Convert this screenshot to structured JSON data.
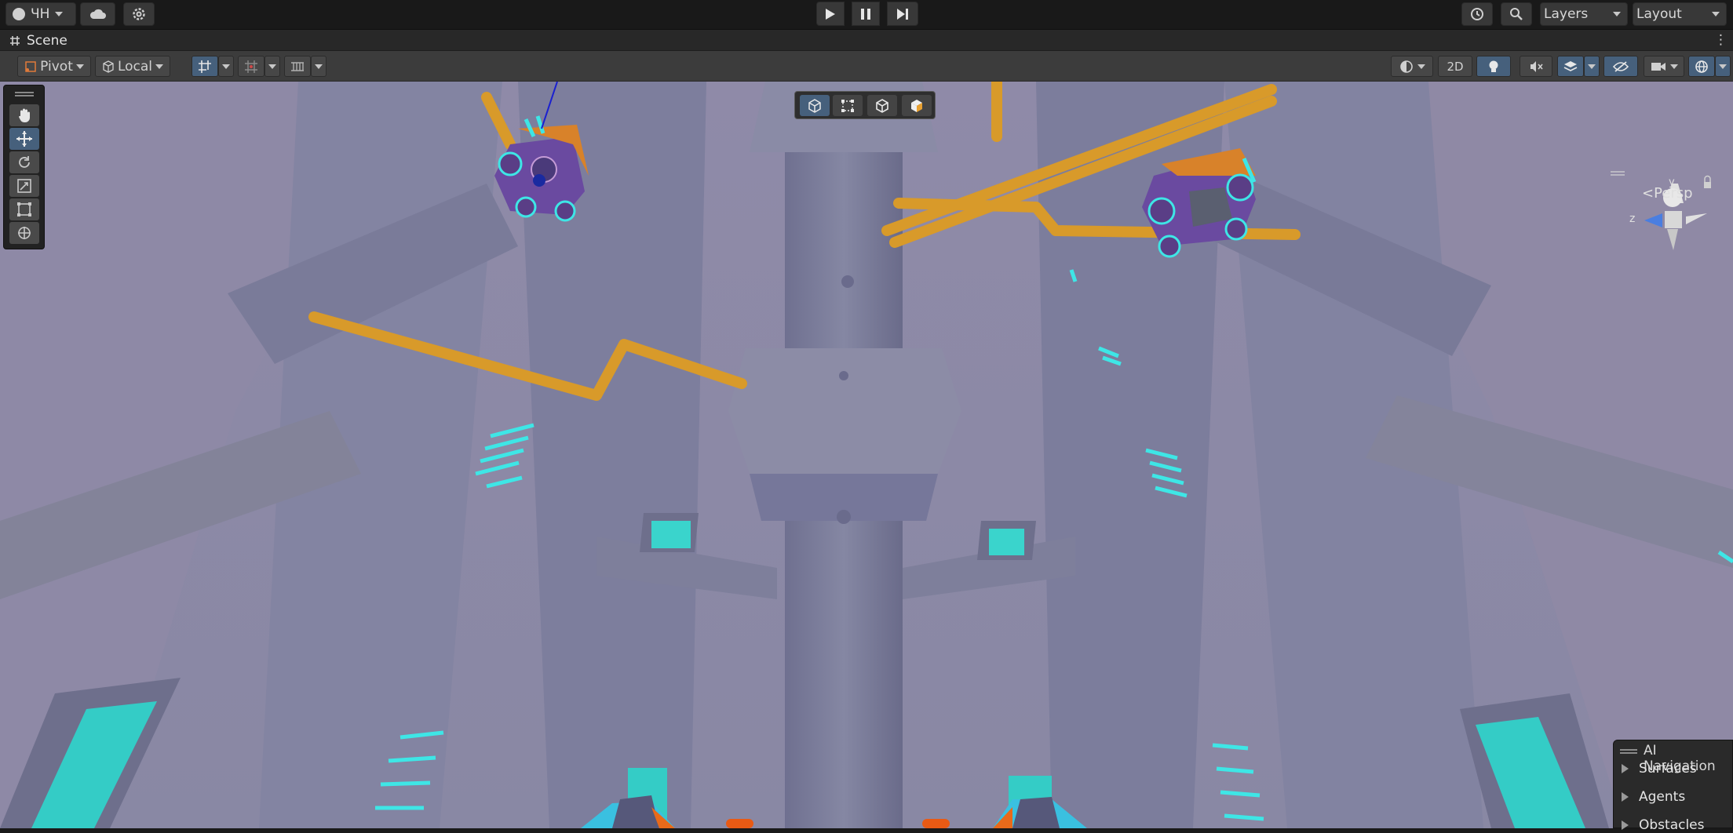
{
  "topbar": {
    "account_label": "ЧН",
    "layers_label": "Layers",
    "layout_label": "Layout",
    "play_icon": "play-icon",
    "pause_icon": "pause-icon",
    "step_icon": "step-icon"
  },
  "scene_tab": {
    "title": "Scene"
  },
  "scene_toolbar": {
    "pivot_label": "Pivot",
    "local_label": "Local",
    "mode_2d_label": "2D"
  },
  "tools": [
    "hand-tool",
    "move-tool",
    "rotate-tool",
    "scale-tool",
    "rect-tool",
    "transform-tool"
  ],
  "gizmo": {
    "projection_label": "Persp",
    "y_axis": "y",
    "z_axis": "z"
  },
  "ai_navigation": {
    "title": "AI Navigation",
    "items": [
      "Surfaces",
      "Agents",
      "Obstacles"
    ]
  },
  "colors": {
    "accent_blue": "#46607c",
    "pipe_orange": "#d89a2a",
    "glow_cyan": "#3ee6e6",
    "sky_lavender": "#8a87a8"
  }
}
